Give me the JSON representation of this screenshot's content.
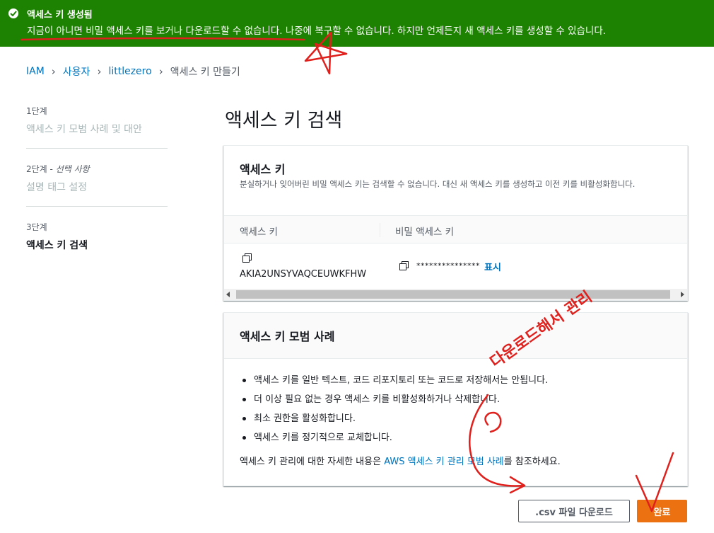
{
  "banner": {
    "title": "액세스 키 생성됨",
    "message": "지금이 아니면 비밀 액세스 키를 보거나 다운로드할 수 없습니다. 나중에 복구할 수 없습니다. 하지만 언제든지 새 액세스 키를 생성할 수 있습니다.",
    "color": "#1d8102"
  },
  "breadcrumb": [
    "IAM",
    "사용자",
    "littlezero",
    "액세스 키 만들기"
  ],
  "steps": [
    {
      "number": "1단계",
      "optional": "",
      "label": "액세스 키 모범 사례 및 대안"
    },
    {
      "number": "2단계 -",
      "optional": "선택 사항",
      "label": "설명 태그 설정"
    },
    {
      "number": "3단계",
      "optional": "",
      "label": "액세스 키 검색"
    }
  ],
  "page_title": "액세스 키 검색",
  "access_key_panel": {
    "title": "액세스 키",
    "description": "분실하거나 잊어버린 비밀 액세스 키는 검색할 수 없습니다. 대신 새 액세스 키를 생성하고 이전 키를 비활성화합니다.",
    "columns": [
      "액세스 키",
      "비밀 액세스 키"
    ],
    "access_key_id": "AKIA2UNSYVAQCEUWKFHW",
    "secret_masked": "***************",
    "show_label": "표시"
  },
  "best_practices_panel": {
    "title": "액세스 키 모범 사례",
    "items": [
      "액세스 키를 일반 텍스트, 코드 리포지토리 또는 코드로 저장해서는 안됩니다.",
      "더 이상 필요 없는 경우 액세스 키를 비활성화하거나 삭제합니다.",
      "최소 권한을 활성화합니다.",
      "액세스 키를 정기적으로 교체합니다."
    ],
    "note_prefix": "액세스 키 관리에 대한 자세한 내용은 ",
    "note_link": "AWS 액세스 키 관리 모범 사례",
    "note_suffix": "를 참조하세요."
  },
  "buttons": {
    "csv": ".csv 파일 다운로드",
    "done": "완료"
  },
  "annotation": {
    "handwriting": "다운로드해서 관리",
    "color": "#e0201c"
  },
  "colors": {
    "link": "#0073bb",
    "primary_button": "#ec7211"
  }
}
